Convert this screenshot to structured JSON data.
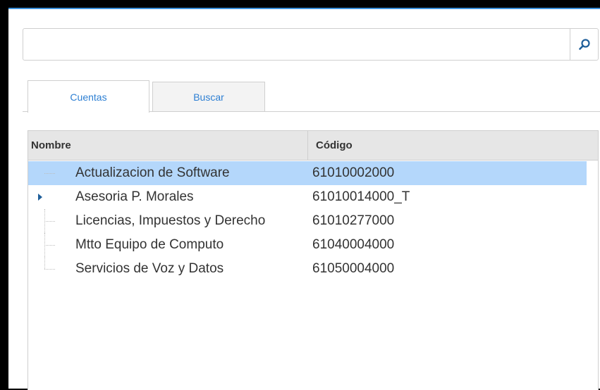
{
  "search": {
    "placeholder": "",
    "value": ""
  },
  "tabs": [
    {
      "label": "Cuentas",
      "active": true
    },
    {
      "label": "Buscar",
      "active": false
    }
  ],
  "grid": {
    "columns": [
      "Nombre",
      "Código"
    ],
    "rows": [
      {
        "name": "Actualizacion de Software",
        "code": "61010002000",
        "selected": true
      },
      {
        "name": "Asesoria P. Morales",
        "code": "61010014000_T",
        "expandable": true
      },
      {
        "name": "Licencias, Impuestos y Derecho",
        "code": "61010277000"
      },
      {
        "name": "Mtto Equipo de Computo",
        "code": "61040004000"
      },
      {
        "name": "Servicios de Voz y Datos",
        "code": "61050004000"
      }
    ]
  },
  "colors": {
    "accent": "#2d7fd3",
    "selected_row": "#b4d7fb",
    "header_bg": "#e6e6e6"
  }
}
